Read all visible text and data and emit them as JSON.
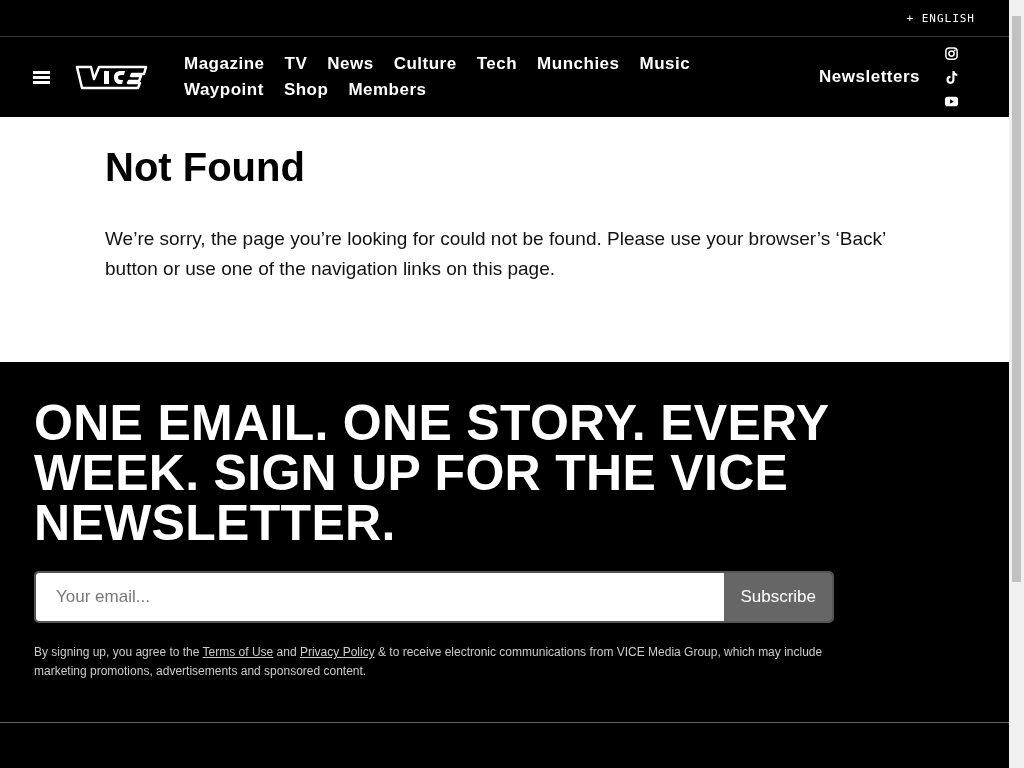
{
  "top_bar": {
    "language": "+ ENGLISH"
  },
  "nav": {
    "items": [
      {
        "label": "Magazine"
      },
      {
        "label": "TV"
      },
      {
        "label": "News"
      },
      {
        "label": "Culture"
      },
      {
        "label": "Tech"
      },
      {
        "label": "Munchies"
      },
      {
        "label": "Music"
      },
      {
        "label": "Waypoint"
      },
      {
        "label": "Shop"
      },
      {
        "label": "Members"
      }
    ],
    "newsletters": "Newsletters",
    "social": [
      {
        "kind": "instagram"
      },
      {
        "kind": "tiktok"
      },
      {
        "kind": "youtube"
      }
    ]
  },
  "content": {
    "title": "Not Found",
    "message": "We’re sorry, the page you’re looking for could not be found. Please use your browser’s ‘Back’ button or use one of the navigation links on this page."
  },
  "signup": {
    "headline": "ONE EMAIL. ONE STORY. EVERY WEEK. SIGN UP FOR THE VICE NEWSLETTER.",
    "placeholder": "Your email...",
    "button": "Subscribe",
    "disclaimer": [
      {
        "kind": "text",
        "text": "By signing up, you agree to the "
      },
      {
        "kind": "link",
        "text": "Terms of Use"
      },
      {
        "kind": "text",
        "text": " and "
      },
      {
        "kind": "link",
        "text": "Privacy Policy"
      },
      {
        "kind": "text",
        "text": " & to receive electronic communications from VICE Media Group, which may include marketing promotions, advertisements and sponsored content."
      }
    ]
  }
}
